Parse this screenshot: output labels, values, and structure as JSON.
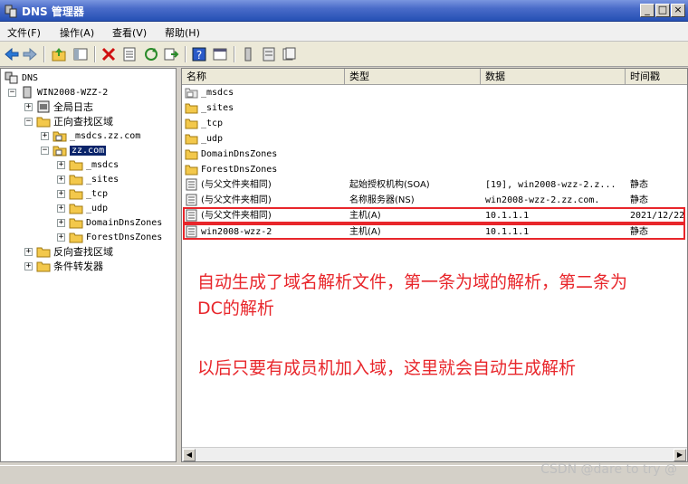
{
  "window": {
    "title": "DNS 管理器"
  },
  "menu": [
    "文件(F)",
    "操作(A)",
    "查看(V)",
    "帮助(H)"
  ],
  "tree": {
    "root": "DNS",
    "server": "WIN2008-WZZ-2",
    "global_log": "全局日志",
    "forward_zones": "正向查找区域",
    "msdcs_zone": "_msdcs.zz.com",
    "zz_zone": "zz.com",
    "zz_children": [
      "_msdcs",
      "_sites",
      "_tcp",
      "_udp",
      "DomainDnsZones",
      "ForestDnsZones"
    ],
    "reverse_zones": "反向查找区域",
    "conditional_forwarders": "条件转发器"
  },
  "list": {
    "columns": [
      "名称",
      "类型",
      "数据",
      "时间戳"
    ],
    "rows": [
      {
        "name": "_msdcs",
        "type": "",
        "data": "",
        "timestamp": ""
      },
      {
        "name": "_sites",
        "type": "",
        "data": "",
        "timestamp": ""
      },
      {
        "name": "_tcp",
        "type": "",
        "data": "",
        "timestamp": ""
      },
      {
        "name": "_udp",
        "type": "",
        "data": "",
        "timestamp": ""
      },
      {
        "name": "DomainDnsZones",
        "type": "",
        "data": "",
        "timestamp": ""
      },
      {
        "name": "ForestDnsZones",
        "type": "",
        "data": "",
        "timestamp": ""
      },
      {
        "name": "(与父文件夹相同)",
        "type": "起始授权机构(SOA)",
        "data": "[19], win2008-wzz-2.z...",
        "timestamp": "静态"
      },
      {
        "name": "(与父文件夹相同)",
        "type": "名称服务器(NS)",
        "data": "win2008-wzz-2.zz.com.",
        "timestamp": "静态"
      },
      {
        "name": "(与父文件夹相同)",
        "type": "主机(A)",
        "data": "10.1.1.1",
        "timestamp": "2021/12/22"
      },
      {
        "name": "win2008-wzz-2",
        "type": "主机(A)",
        "data": "10.1.1.1",
        "timestamp": "静态"
      }
    ]
  },
  "annotation": {
    "line1": "自动生成了域名解析文件，第一条为域的解析，第二条为",
    "line2": "DC的解析",
    "line3": "以后只要有成员机加入域，这里就会自动生成解析"
  },
  "watermark": "CSDN @dare to try @",
  "colors": {
    "highlight": "#e8262b",
    "selection": "#0a246a"
  }
}
